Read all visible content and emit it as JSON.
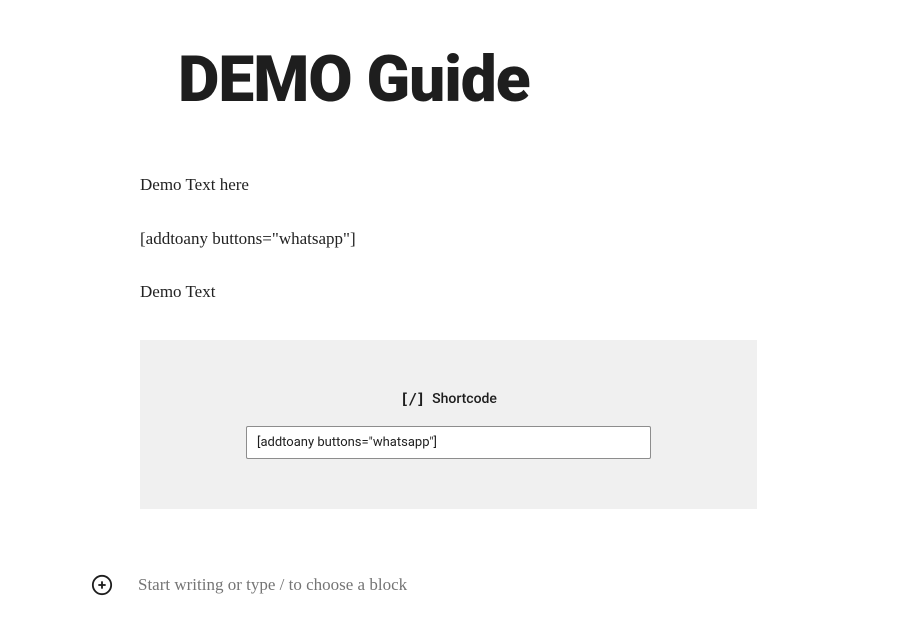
{
  "title": "DEMO Guide",
  "paragraphs": {
    "p1": "Demo Text here",
    "p2": " [addtoany buttons=\"whatsapp\"]",
    "p3": "Demo Text"
  },
  "shortcode_block": {
    "icon_text": "[/]",
    "label": "Shortcode",
    "value": "[addtoany buttons=\"whatsapp\"]"
  },
  "new_block": {
    "placeholder": "Start writing or type / to choose a block"
  }
}
